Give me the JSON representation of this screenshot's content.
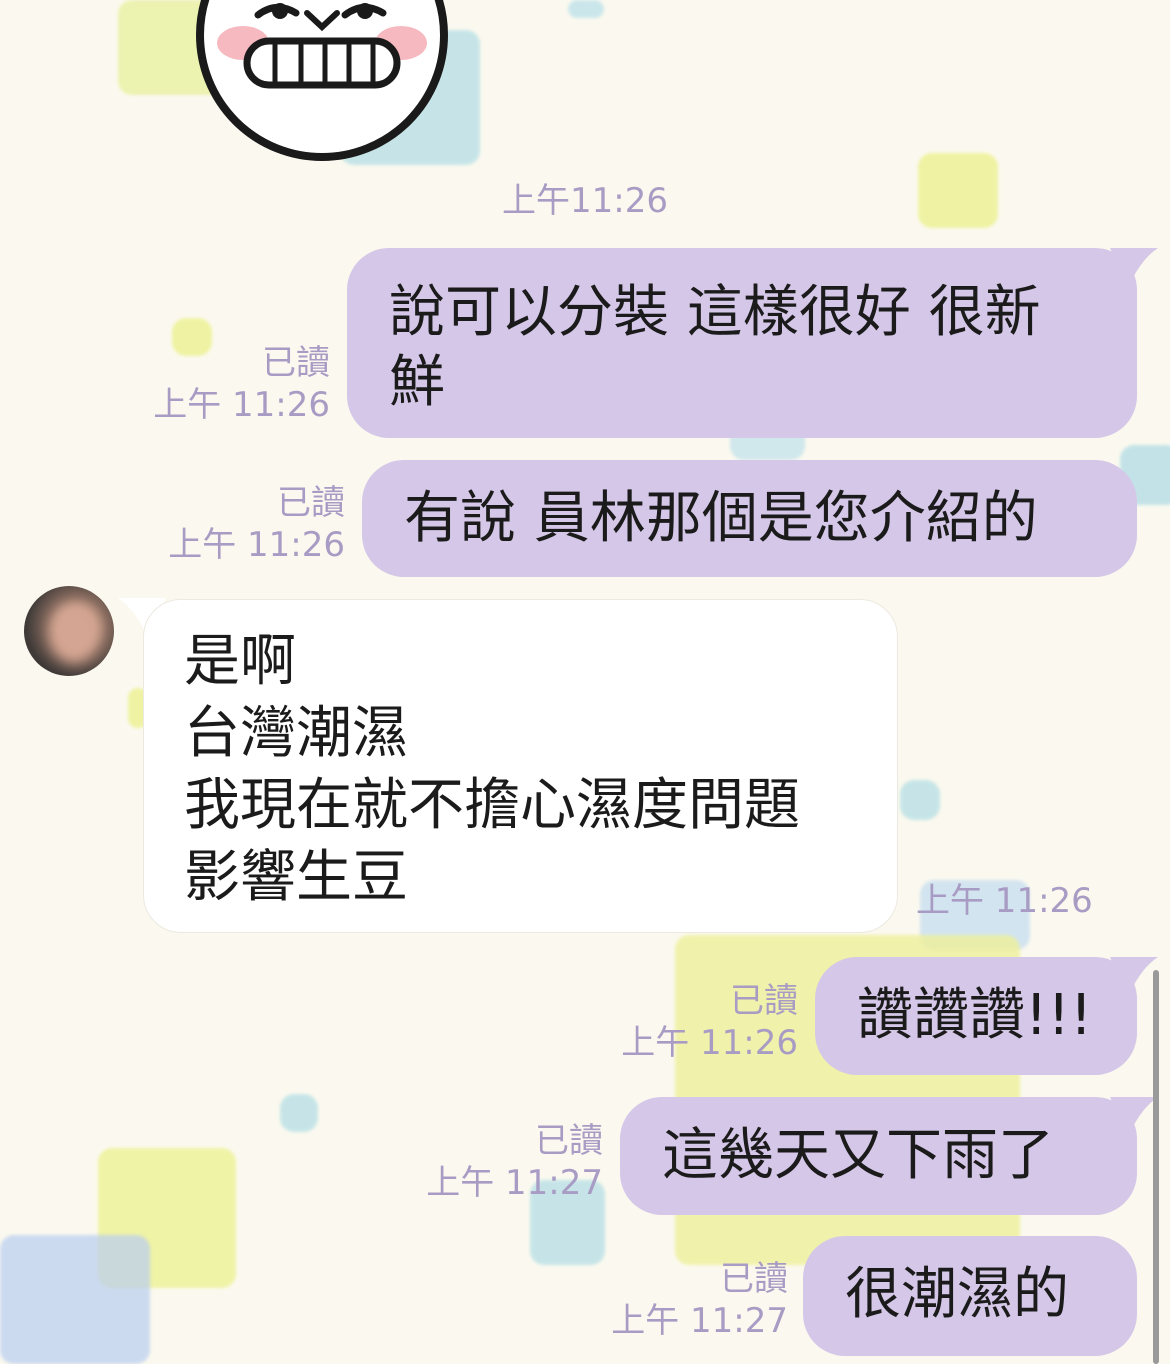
{
  "colors": {
    "outgoing_bubble": "#d5c7e8",
    "incoming_bubble": "#ffffff",
    "meta_text": "#a89cc4",
    "background": "#fbf9ef"
  },
  "sticker": {
    "icon": "grinning-face-sticker"
  },
  "date_divider": {
    "time": "上午11:26"
  },
  "messages": [
    {
      "direction": "outgoing",
      "lines": [
        "說可以分裝 這樣很好 很新",
        "鮮"
      ],
      "read": "已讀",
      "time": "上午 11:26"
    },
    {
      "direction": "outgoing",
      "lines": [
        "有說 員林那個是您介紹的"
      ],
      "read": "已讀",
      "time": "上午 11:26"
    },
    {
      "direction": "incoming",
      "avatar": "blurred-contact-avatar",
      "lines": [
        "是啊",
        "台灣潮濕",
        "我現在就不擔心濕度問題",
        "影響生豆"
      ],
      "time": "上午 11:26"
    },
    {
      "direction": "outgoing",
      "lines": [
        "讚讚讚!!!"
      ],
      "read": "已讀",
      "time": "上午 11:26"
    },
    {
      "direction": "outgoing",
      "lines": [
        "這幾天又下雨了"
      ],
      "read": "已讀",
      "time": "上午 11:27"
    },
    {
      "direction": "outgoing",
      "lines": [
        "很潮濕的"
      ],
      "read": "已讀",
      "time": "上午 11:27"
    }
  ]
}
